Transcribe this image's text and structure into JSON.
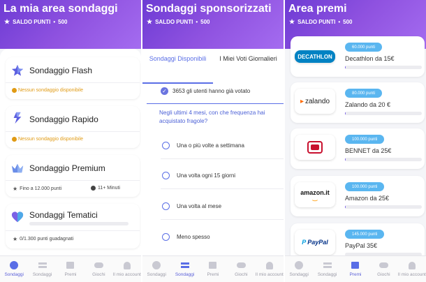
{
  "panel1": {
    "title": "La mia area sondaggi",
    "points_label": "SALDO PUNTI",
    "points_value": "500",
    "cards": [
      {
        "title": "Sondaggio Flash",
        "status": "Nessun sondaggio disponibile",
        "icon": "star-icon",
        "color": "#5c5fe0"
      },
      {
        "title": "Sondaggio Rapido",
        "status": "Nessun sondaggio disponibile",
        "icon": "lightning-icon",
        "color": "#5c5fe0"
      },
      {
        "title": "Sondaggio Premium",
        "points": "Fino a 12.000 punti",
        "time": "11+ Minuti",
        "icon": "crown-icon",
        "color": "#6a8de8"
      },
      {
        "title": "Sondaggi Tematici",
        "earned": "0/1.300 punti guadagnati",
        "progress": 0,
        "icon": "heart-icon",
        "color": "#7b61e5"
      }
    ]
  },
  "panel2": {
    "title": "Sondaggi sponsorizzati",
    "points_label": "SALDO PUNTI",
    "points_value": "500",
    "tabs": [
      {
        "label": "Sondaggi Disponibili",
        "active": true
      },
      {
        "label": "I Miei Voti Giornalieri",
        "active": false
      }
    ],
    "voted_text": "3653 gli utenti hanno già votato",
    "question": "Negli ultimi 4 mesi, con che frequenza hai acquistato fragole?",
    "options": [
      "Una o più volte a settimana",
      "Una volta ogni 15 giorni",
      "Una volta al mese",
      "Meno spesso"
    ]
  },
  "panel3": {
    "title": "Area premi",
    "points_label": "SALDO PUNTI",
    "points_value": "500",
    "prizes": [
      {
        "brand": "DECATHLON",
        "points": "60.000 punti",
        "name": "Decathlon da 15€",
        "progress": 0.01
      },
      {
        "brand": "zalando",
        "points": "80.000 punti",
        "name": "Zalando da 20 €",
        "progress": 0.01
      },
      {
        "brand": "BENNET",
        "points": "100.000 punti",
        "name": "BENNET da 25€",
        "progress": 0.01
      },
      {
        "brand": "amazon.it",
        "points": "100.000 punti",
        "name": "Amazon da 25€",
        "progress": 0.01
      },
      {
        "brand": "PayPal",
        "points": "145.000 punti",
        "name": "PayPal 35€",
        "progress": 0.0
      }
    ]
  },
  "nav": {
    "items": [
      "Sondaggi",
      "Sondaggi",
      "Premi",
      "Giochi",
      "Il mio account"
    ]
  },
  "colors": {
    "accent": "#5a6ee6",
    "header_from": "#6d3bd4",
    "header_to": "#a46cf0",
    "warning": "#e09a14",
    "pill": "#5ab6f0"
  }
}
